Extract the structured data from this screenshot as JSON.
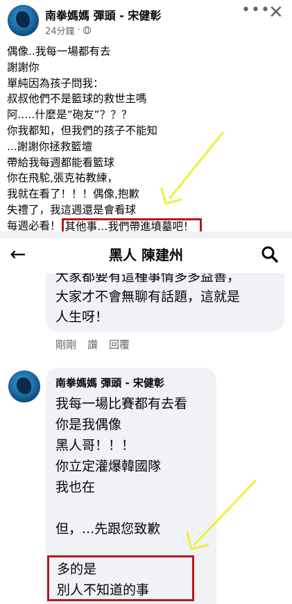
{
  "post": {
    "author": "南拳媽媽 彈頭 - 宋健彰",
    "time": "24分鐘",
    "meta_separator": "·",
    "lines": [
      "偶像..我每一場都有去",
      "謝謝你",
      "單純因為孩子問我：",
      "叔叔他們不是籃球的救世主嗎",
      "阿.....什麼是”砲友”？？？",
      "你我都知，但我們的孩子不能知",
      "...謝謝你拯救籃壇",
      "帶給我每週都能看籃球",
      "你在飛駝,張克祐教練，",
      "我就在看了！！！偶像,抱歉",
      "失禮了，我這週還是會看球"
    ],
    "last_line_prefix": "每週必看！",
    "last_line_highlight": "其他事…我們帶進墳墓吧！"
  },
  "comments_header": {
    "title": "黑人 陳建州"
  },
  "comment1": {
    "lines": [
      "大家都要有這種事情多多益善，",
      "大家才不會無聊有話題，這就是",
      "人生呀！"
    ],
    "actions": [
      "剛剛",
      "讚",
      "回覆"
    ]
  },
  "comment2": {
    "author": "南拳媽媽 彈頭 - 宋健彰",
    "lines": [
      "我每一場比賽都有去看",
      "你是我偶像",
      "黑人哥！！！",
      "你立定灌爆韓國隊",
      "我也在",
      "",
      "但，...先跟您致歉"
    ],
    "highlight_lines": [
      "多的是",
      "別人不知道的事"
    ]
  },
  "colors": {
    "highlight_box": "#b3191c",
    "arrow": "#eef03a",
    "bubble": "#f0f2f5",
    "secondary_text": "#65676b"
  },
  "icons": {
    "more": "more-icon",
    "close": "close-icon",
    "back": "back-arrow-icon",
    "search": "search-icon",
    "privacy": "globe-icon"
  }
}
